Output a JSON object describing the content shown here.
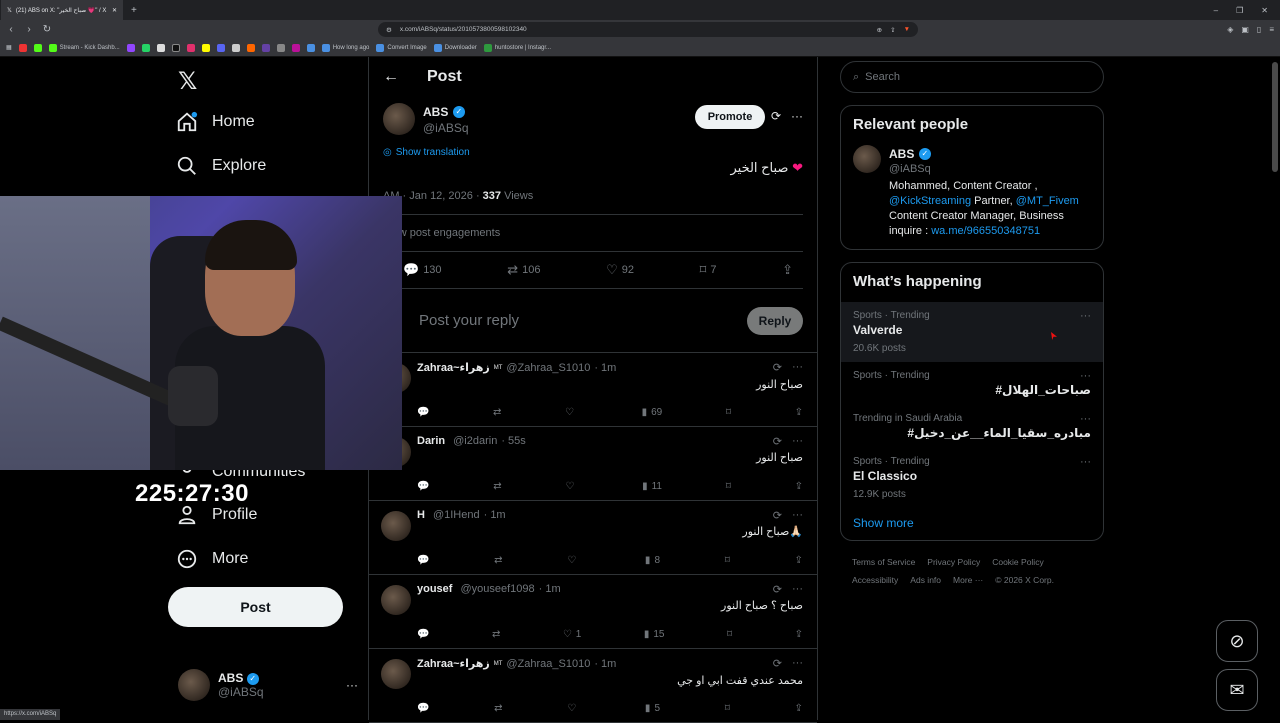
{
  "browser": {
    "tab_title": "(21) ABS on X: \"صباح الخير 💗\" / X",
    "url": "x.com/iABSq/status/2010573800598102340",
    "status_url": "https://x.com/iABSq",
    "bookmarks": [
      "Stream - Kick Dashb...",
      "How long ago",
      "Convert Image",
      "Downloader",
      "huntostore | Instagr..."
    ]
  },
  "nav": {
    "home": "Home",
    "explore": "Explore",
    "communities": "Communities",
    "profile": "Profile",
    "more": "More",
    "post": "Post"
  },
  "timer": "225:27:30",
  "account": {
    "name": "ABS",
    "handle": "@iABSq"
  },
  "header": {
    "title": "Post"
  },
  "main_post": {
    "name": "ABS",
    "handle": "@iABSq",
    "promote": "Promote",
    "show_translation": "Show translation",
    "text": "صباح الخير",
    "time": "AM · Jan 12, 2026 ·",
    "views_count": "337",
    "views_label": "Views",
    "engagements": "View post engagements",
    "replies": "130",
    "reposts": "106",
    "likes": "92",
    "bookmarks": "7"
  },
  "reply_box": {
    "placeholder": "Post your reply",
    "button": "Reply"
  },
  "replies": [
    {
      "name": "Zahraa~زهراء",
      "badge": "MT",
      "handle": "@Zahraa_S1010",
      "time": "· 1m",
      "text": "صباح النور",
      "likes": "",
      "views": "69"
    },
    {
      "name": "Darin",
      "badge": "",
      "handle": "@i2darin",
      "time": "· 55s",
      "text": "صباح النور",
      "likes": "",
      "views": "11"
    },
    {
      "name": "H",
      "badge": "",
      "handle": "@1IHend",
      "time": "· 1m",
      "text": "صباح النور🙏🏻",
      "likes": "",
      "views": "8"
    },
    {
      "name": "yousef",
      "badge": "",
      "handle": "@youseef1098",
      "time": "· 1m",
      "text": "صباح ؟ صباح النور",
      "likes": "1",
      "views": "15"
    },
    {
      "name": "Zahraa~زهراء",
      "badge": "MT",
      "handle": "@Zahraa_S1010",
      "time": "· 1m",
      "text": "محمد عندي قفت ابي او جي",
      "likes": "",
      "views": "5"
    }
  ],
  "search": {
    "placeholder": "Search"
  },
  "relevant": {
    "title": "Relevant people",
    "name": "ABS",
    "handle": "@iABSq",
    "bio_1": "Mohammed, Content Creator ,",
    "bio_link_1": "@KickStreaming",
    "bio_2": " Partner, ",
    "bio_link_2": "@MT_Fivem",
    "bio_3": "Content Creator Manager, Business inquire : ",
    "bio_link_3": "wa.me/966550348751"
  },
  "happening": {
    "title": "What’s happening",
    "trends": [
      {
        "category": "Sports · Trending",
        "title": "Valverde",
        "count": "20.6K posts"
      },
      {
        "category": "Sports · Trending",
        "title": "#صباحات_الهلال",
        "count": ""
      },
      {
        "category": "Trending in Saudi Arabia",
        "title": "#مبادره_سقيا_الماء__عن_دخيل",
        "count": ""
      },
      {
        "category": "Sports · Trending",
        "title": "El Classico",
        "count": "12.9K posts"
      }
    ],
    "show_more": "Show more"
  },
  "footer": [
    "Terms of Service",
    "Privacy Policy",
    "Cookie Policy",
    "Accessibility",
    "Ads info",
    "More ···",
    "© 2026 X Corp."
  ],
  "colors": {
    "accent": "#1d9bf0",
    "background": "#000000",
    "border": "#2f3336",
    "muted": "#71767b"
  }
}
